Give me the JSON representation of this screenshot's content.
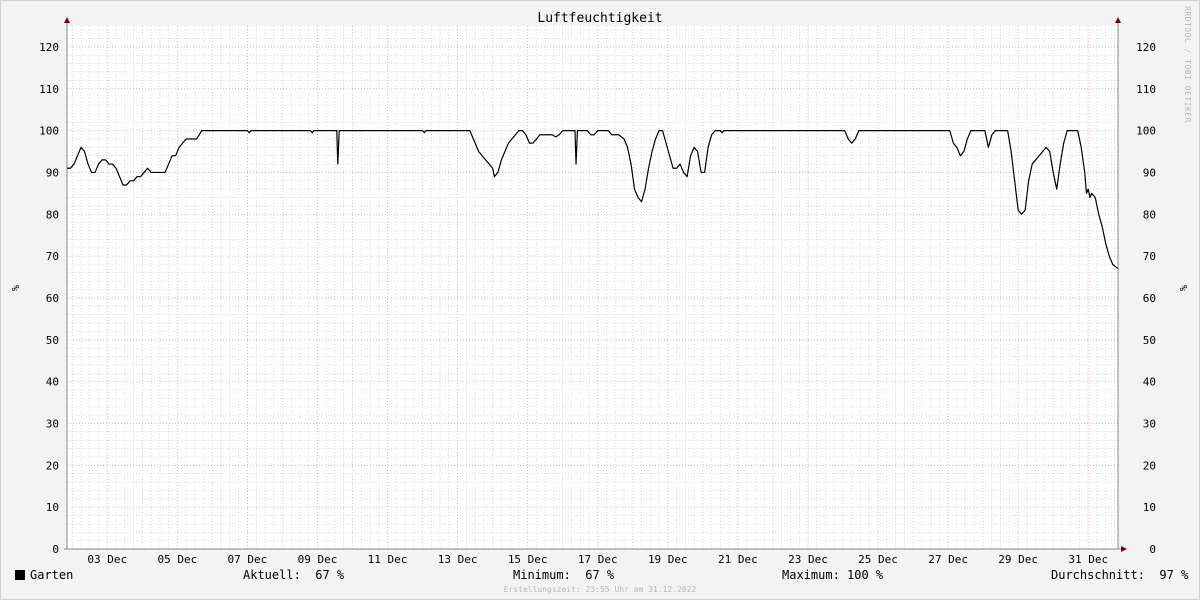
{
  "title": "Luftfeuchtigkeit",
  "watermark": "RRDTOOL / TOBI OETIKER",
  "colors": {
    "background": "#f3f3f3",
    "canvas": "#ffffff",
    "minor_grid": "#c8c8c8",
    "major_grid": "#e8a3a3",
    "axis": "#888888",
    "arrow": "#800000",
    "series": "#000000"
  },
  "chart_data": {
    "type": "line",
    "title": "Luftfeuchtigkeit",
    "ylabel": "%",
    "xlabel": "",
    "ylim": [
      0,
      125
    ],
    "xlim_day": [
      1.85,
      31.85
    ],
    "yticks": [
      0,
      10,
      20,
      30,
      40,
      50,
      60,
      70,
      80,
      90,
      100,
      110,
      120
    ],
    "xtick_labels": [
      "03 Dec",
      "05 Dec",
      "07 Dec",
      "09 Dec",
      "11 Dec",
      "13 Dec",
      "15 Dec",
      "17 Dec",
      "19 Dec",
      "21 Dec",
      "23 Dec",
      "25 Dec",
      "27 Dec",
      "29 Dec",
      "31 Dec"
    ],
    "xtick_days": [
      3,
      5,
      7,
      9,
      11,
      13,
      15,
      17,
      19,
      21,
      23,
      25,
      27,
      29,
      31
    ],
    "grid": true,
    "y_axis_both_sides": true,
    "series": [
      {
        "name": "Garten",
        "color": "#000000",
        "points": [
          [
            1.85,
            91
          ],
          [
            1.95,
            91
          ],
          [
            2.05,
            92
          ],
          [
            2.15,
            94
          ],
          [
            2.25,
            96
          ],
          [
            2.35,
            95
          ],
          [
            2.45,
            92
          ],
          [
            2.55,
            90
          ],
          [
            2.65,
            90
          ],
          [
            2.75,
            92
          ],
          [
            2.85,
            93
          ],
          [
            2.95,
            93
          ],
          [
            3.05,
            92
          ],
          [
            3.15,
            92
          ],
          [
            3.25,
            91
          ],
          [
            3.35,
            89
          ],
          [
            3.45,
            87
          ],
          [
            3.55,
            87
          ],
          [
            3.65,
            88
          ],
          [
            3.75,
            88
          ],
          [
            3.85,
            89
          ],
          [
            3.95,
            89
          ],
          [
            4.05,
            90
          ],
          [
            4.15,
            91
          ],
          [
            4.25,
            90
          ],
          [
            4.35,
            90
          ],
          [
            4.45,
            90
          ],
          [
            4.55,
            90
          ],
          [
            4.65,
            90
          ],
          [
            4.75,
            92
          ],
          [
            4.85,
            94
          ],
          [
            4.95,
            94
          ],
          [
            5.05,
            96
          ],
          [
            5.15,
            97
          ],
          [
            5.25,
            98
          ],
          [
            5.35,
            98
          ],
          [
            5.45,
            98
          ],
          [
            5.55,
            98
          ],
          [
            5.7,
            100
          ],
          [
            7.0,
            100
          ],
          [
            7.05,
            99.5
          ],
          [
            7.1,
            100
          ],
          [
            8.8,
            100
          ],
          [
            8.85,
            99.5
          ],
          [
            8.9,
            100
          ],
          [
            9.55,
            100
          ],
          [
            9.58,
            92
          ],
          [
            9.62,
            100
          ],
          [
            12.0,
            100
          ],
          [
            12.05,
            99.5
          ],
          [
            12.1,
            100
          ],
          [
            13.35,
            100
          ],
          [
            13.5,
            97
          ],
          [
            13.6,
            95
          ],
          [
            13.7,
            94
          ],
          [
            13.8,
            93
          ],
          [
            13.9,
            92
          ],
          [
            14.0,
            91
          ],
          [
            14.05,
            89
          ],
          [
            14.15,
            90
          ],
          [
            14.25,
            93
          ],
          [
            14.35,
            95
          ],
          [
            14.45,
            97
          ],
          [
            14.55,
            98
          ],
          [
            14.65,
            99
          ],
          [
            14.75,
            100
          ],
          [
            14.85,
            100
          ],
          [
            14.95,
            99
          ],
          [
            15.05,
            97
          ],
          [
            15.15,
            97
          ],
          [
            15.25,
            98
          ],
          [
            15.35,
            99
          ],
          [
            15.45,
            99
          ],
          [
            15.7,
            99
          ],
          [
            15.8,
            98.5
          ],
          [
            15.9,
            99
          ],
          [
            16.0,
            100
          ],
          [
            16.35,
            100
          ],
          [
            16.38,
            92
          ],
          [
            16.42,
            100
          ],
          [
            16.5,
            100
          ],
          [
            16.6,
            100
          ],
          [
            16.7,
            100
          ],
          [
            16.8,
            99
          ],
          [
            16.9,
            99
          ],
          [
            17.0,
            100
          ],
          [
            17.3,
            100
          ],
          [
            17.4,
            99
          ],
          [
            17.6,
            99
          ],
          [
            17.75,
            98
          ],
          [
            17.85,
            96
          ],
          [
            17.95,
            92
          ],
          [
            18.05,
            86
          ],
          [
            18.15,
            84
          ],
          [
            18.25,
            83
          ],
          [
            18.35,
            86
          ],
          [
            18.45,
            91
          ],
          [
            18.55,
            95
          ],
          [
            18.65,
            98
          ],
          [
            18.75,
            100
          ],
          [
            18.85,
            100
          ],
          [
            18.95,
            97
          ],
          [
            19.05,
            94
          ],
          [
            19.15,
            91
          ],
          [
            19.25,
            91
          ],
          [
            19.35,
            92
          ],
          [
            19.45,
            90
          ],
          [
            19.55,
            89
          ],
          [
            19.65,
            94
          ],
          [
            19.75,
            96
          ],
          [
            19.85,
            95
          ],
          [
            19.95,
            90
          ],
          [
            20.05,
            90
          ],
          [
            20.15,
            96
          ],
          [
            20.25,
            99
          ],
          [
            20.35,
            100
          ],
          [
            20.5,
            100
          ],
          [
            20.55,
            99.5
          ],
          [
            20.6,
            100
          ],
          [
            24.05,
            100
          ],
          [
            24.15,
            98
          ],
          [
            24.25,
            97
          ],
          [
            24.35,
            98
          ],
          [
            24.45,
            100
          ],
          [
            27.05,
            100
          ],
          [
            27.15,
            97
          ],
          [
            27.25,
            96
          ],
          [
            27.35,
            94
          ],
          [
            27.45,
            95
          ],
          [
            27.55,
            98
          ],
          [
            27.65,
            100
          ],
          [
            28.05,
            100
          ],
          [
            28.15,
            96
          ],
          [
            28.25,
            99
          ],
          [
            28.35,
            100
          ],
          [
            28.7,
            100
          ],
          [
            28.8,
            95
          ],
          [
            28.9,
            88
          ],
          [
            29.0,
            81
          ],
          [
            29.1,
            80
          ],
          [
            29.2,
            81
          ],
          [
            29.3,
            88
          ],
          [
            29.4,
            92
          ],
          [
            29.5,
            93
          ],
          [
            29.6,
            94
          ],
          [
            29.7,
            95
          ],
          [
            29.8,
            96
          ],
          [
            29.9,
            95
          ],
          [
            30.0,
            90
          ],
          [
            30.1,
            86
          ],
          [
            30.2,
            92
          ],
          [
            30.3,
            97
          ],
          [
            30.4,
            100
          ],
          [
            30.7,
            100
          ],
          [
            30.8,
            96
          ],
          [
            30.9,
            90
          ],
          [
            30.95,
            85
          ],
          [
            31.0,
            86
          ],
          [
            31.05,
            84
          ],
          [
            31.1,
            85
          ],
          [
            31.2,
            84
          ],
          [
            31.3,
            80
          ],
          [
            31.4,
            77
          ],
          [
            31.5,
            73
          ],
          [
            31.6,
            70
          ],
          [
            31.7,
            68
          ],
          [
            31.85,
            67
          ]
        ]
      }
    ]
  },
  "legend": {
    "series_name": "Garten",
    "current": "Aktuell:  67 %",
    "minimum": "Minimum:  67 %",
    "maximum": "Maximum: 100 %",
    "average": "Durchschnitt:  97 %"
  },
  "creation": "Erstellungszeit: 23:55 Uhr am 31.12.2022"
}
